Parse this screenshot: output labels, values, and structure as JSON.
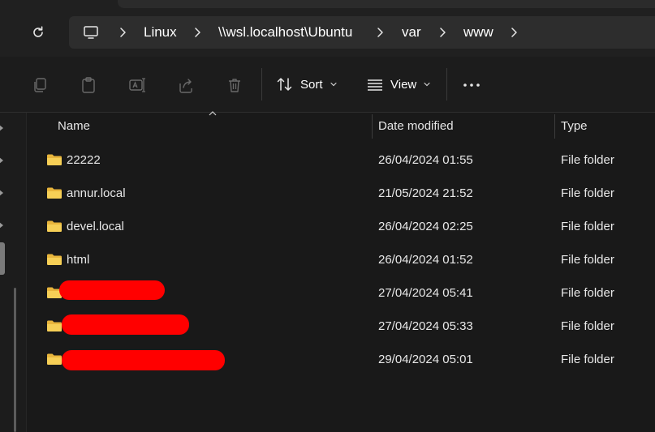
{
  "address": {
    "breadcrumbs": [
      "Linux",
      "\\\\wsl.localhost\\Ubuntu",
      "var",
      "www"
    ]
  },
  "toolbar": {
    "sort_label": "Sort",
    "view_label": "View"
  },
  "columns": {
    "name": "Name",
    "date_modified": "Date modified",
    "type": "Type"
  },
  "files": [
    {
      "name": "22222",
      "date": "26/04/2024 01:55",
      "type": "File folder"
    },
    {
      "name": "annur.local",
      "date": "21/05/2024 21:52",
      "type": "File folder"
    },
    {
      "name": "devel.local",
      "date": "26/04/2024 02:25",
      "type": "File folder"
    },
    {
      "name": "html",
      "date": "26/04/2024 01:52",
      "type": "File folder"
    },
    {
      "name": "",
      "date": "27/04/2024 05:41",
      "type": "File folder"
    },
    {
      "name": "",
      "date": "27/04/2024 05:33",
      "type": "File folder"
    },
    {
      "name": "",
      "date": "29/04/2024 05:01",
      "type": "File folder"
    }
  ],
  "colors": {
    "folder": "#f3c94a",
    "redaction": "#ff0000",
    "background": "#191919"
  },
  "icons": [
    "refresh-icon",
    "this-pc-icon",
    "copy-icon",
    "paste-icon",
    "rename-icon",
    "share-icon",
    "delete-icon",
    "sort-icon",
    "view-icon",
    "more-icon",
    "folder-icon"
  ]
}
